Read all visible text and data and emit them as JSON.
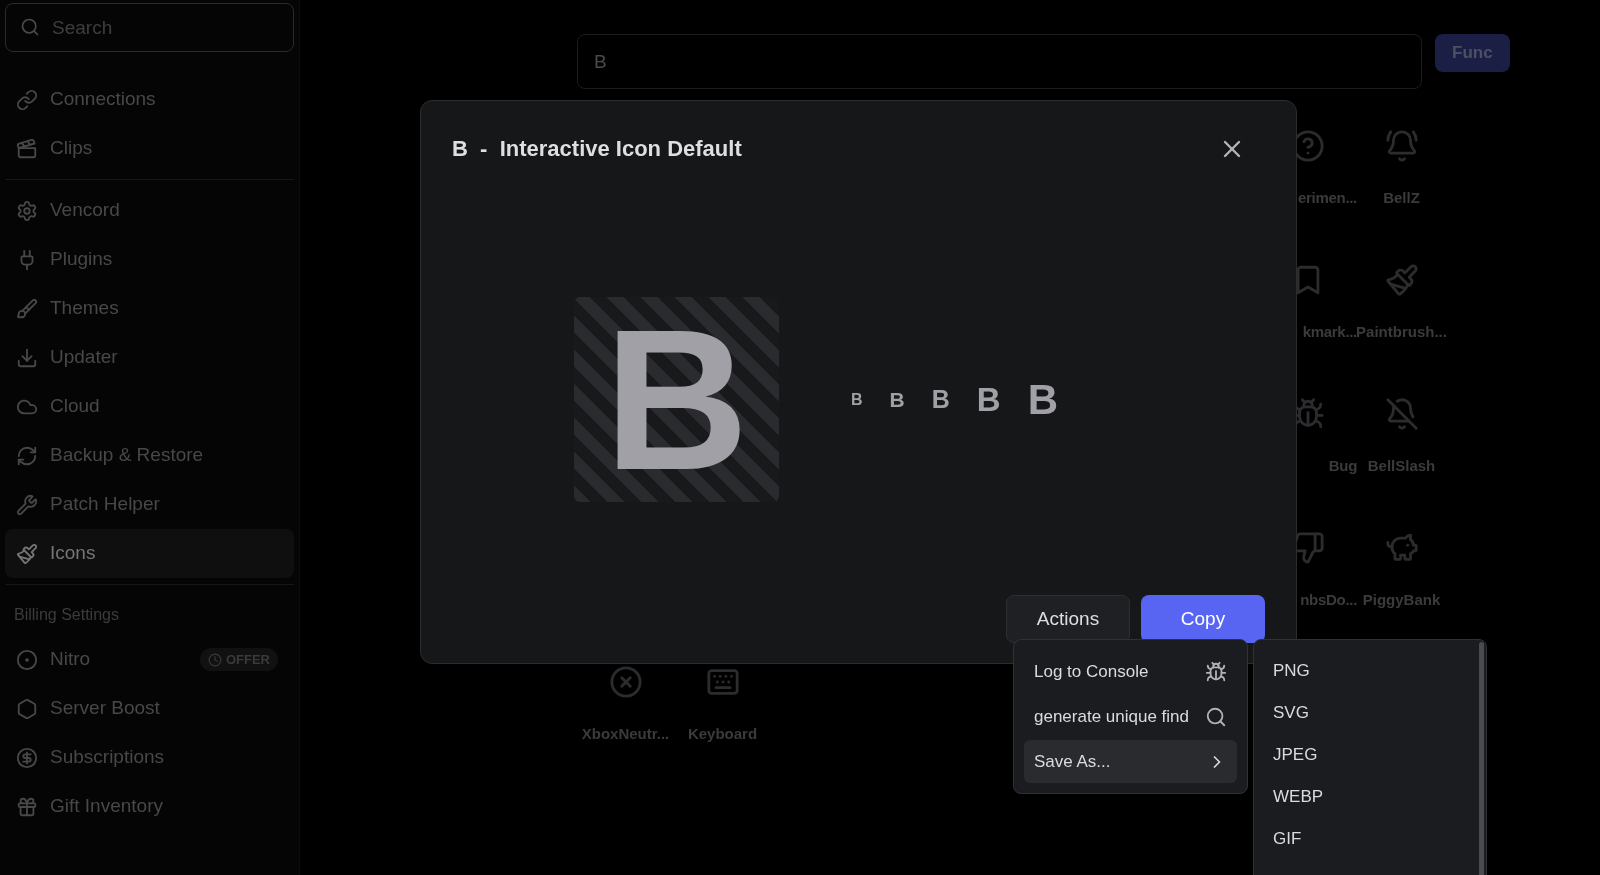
{
  "sidebar": {
    "search": {
      "placeholder": "Search"
    },
    "sections": [
      {
        "items": [
          {
            "label": "Connections",
            "selected": false
          },
          {
            "label": "Clips",
            "selected": false
          }
        ]
      },
      {
        "items": [
          {
            "label": "Vencord",
            "selected": false
          },
          {
            "label": "Plugins",
            "selected": false
          },
          {
            "label": "Themes",
            "selected": false
          },
          {
            "label": "Updater",
            "selected": false
          },
          {
            "label": "Cloud",
            "selected": false
          },
          {
            "label": "Backup & Restore",
            "selected": false
          },
          {
            "label": "Patch Helper",
            "selected": false
          },
          {
            "label": "Icons",
            "selected": true
          }
        ]
      },
      {
        "header": "Billing Settings",
        "items": [
          {
            "label": "Nitro",
            "selected": false,
            "badge": "OFFER"
          },
          {
            "label": "Server Boost",
            "selected": false
          },
          {
            "label": "Subscriptions",
            "selected": false
          },
          {
            "label": "Gift Inventory",
            "selected": false
          }
        ]
      }
    ]
  },
  "main": {
    "search": {
      "value": "B"
    },
    "func_button": "Func",
    "icon_grid": {
      "rows": [
        {
          "tiles": [
            {
              "label": "erimen...",
              "cut": true
            },
            {
              "label": "BellZ",
              "cut": false
            }
          ]
        },
        {
          "tiles": [
            {
              "label": "kmark...",
              "cut": true
            },
            {
              "label": "Paintbrush...",
              "cut": false
            }
          ]
        },
        {
          "tiles": [
            {
              "label": "Bug",
              "cut": true
            },
            {
              "label": "BellSlash",
              "cut": false
            }
          ]
        },
        {
          "tiles": [
            {
              "label": "nbsDo...",
              "cut": true
            },
            {
              "label": "PiggyBank",
              "cut": false
            }
          ]
        },
        {
          "tiles": [
            {
              "label": "XboxNeutr...",
              "cut": false
            },
            {
              "label": "Keyboard",
              "cut": false
            }
          ]
        }
      ]
    }
  },
  "modal": {
    "title": "B  -  Interactive Icon Default",
    "large_preview": "B",
    "previews": [
      "B",
      "B",
      "B",
      "B",
      "B"
    ],
    "buttons": [
      {
        "label": "Actions",
        "kind": "secondary"
      },
      {
        "label": "Copy",
        "kind": "primary"
      }
    ]
  },
  "actions_menu": {
    "items": [
      {
        "label": "Log to Console",
        "kind": "bug",
        "selected": false
      },
      {
        "label": "generate unique find",
        "kind": "search",
        "selected": false
      },
      {
        "label": "Save As...",
        "kind": "submenu",
        "selected": true
      }
    ]
  },
  "save_as_menu": {
    "items": [
      "PNG",
      "SVG",
      "JPEG",
      "WEBP",
      "GIF"
    ]
  }
}
